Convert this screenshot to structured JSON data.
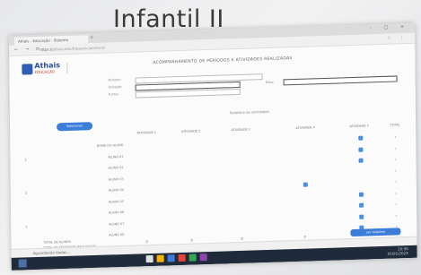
{
  "slide": {
    "title": "Infantil II"
  },
  "browser": {
    "tab_title": "Athaís - Educação - Sistema",
    "tab_close": "×",
    "window_controls": "– ▢ ×",
    "nav_icons": "← → ⟳",
    "url_host": "https://",
    "url_path": "athais.edu/frequencia/infantil",
    "addr_icons": "☆ ⋮"
  },
  "app": {
    "logo_text": "Athais",
    "logo_sub": "EDUCAÇÃO",
    "logo_right": "",
    "page_heading": "ACOMPANHAMENTO DE PERÍODOS E ATIVIDADES REALIZADAS",
    "filters": {
      "label_1": "Período:",
      "label_2": "Unidade:",
      "label_3": "Turma:",
      "label_right": "Data:"
    },
    "section_label": "Relatório de atividades",
    "side_button": "Selecionar"
  },
  "table": {
    "columns": [
      "ATIVIDADE 1",
      "ATIVIDADE 2",
      "ATIVIDADE 3",
      "ATIVIDADE 4",
      "ATIVIDADE 5",
      "TOTAL"
    ],
    "rows": [
      {
        "num": "",
        "name": "NOME DO ALUNO",
        "marks": [
          0,
          0,
          0,
          0,
          1
        ],
        "dot": "•"
      },
      {
        "num": "1",
        "name": "ALUNO 01",
        "marks": [
          0,
          0,
          0,
          0,
          1
        ],
        "dot": "•"
      },
      {
        "num": "",
        "name": "ALUNO 02",
        "marks": [
          0,
          0,
          0,
          0,
          1
        ],
        "dot": "•"
      },
      {
        "num": "",
        "name": "ALUNO 03",
        "marks": [
          0,
          0,
          0,
          0,
          0
        ],
        "dot": "•"
      },
      {
        "num": "2",
        "name": "ALUNO 04",
        "marks": [
          0,
          0,
          0,
          1,
          0
        ],
        "dot": "•"
      },
      {
        "num": "",
        "name": "ALUNO 05",
        "marks": [
          0,
          0,
          0,
          0,
          1
        ],
        "dot": "•"
      },
      {
        "num": "",
        "name": "ALUNO 06",
        "marks": [
          0,
          0,
          0,
          0,
          1
        ],
        "dot": "•"
      },
      {
        "num": "3",
        "name": "ALUNO 07",
        "marks": [
          0,
          0,
          0,
          0,
          1
        ],
        "dot": "•"
      },
      {
        "num": "",
        "name": "ALUNO 08",
        "marks": [
          0,
          0,
          0,
          0,
          1
        ],
        "dot": "•"
      }
    ],
    "totals": {
      "label_1": "TOTAL DE ALUNOS",
      "label_2": "TOTAL DE ATIVIDADES REALIZADAS",
      "values": [
        "",
        "0",
        "0",
        "0",
        "0",
        "0"
      ],
      "button": "ver relatório"
    }
  },
  "statusbar": {
    "text": "Aguardando dados..."
  },
  "taskbar": {
    "time": "10:30",
    "date": "01/01/2023"
  },
  "colors": {
    "accent": "#3b7dd8",
    "mark": "#4a90e2",
    "taskbar": "#1f2a3a"
  }
}
